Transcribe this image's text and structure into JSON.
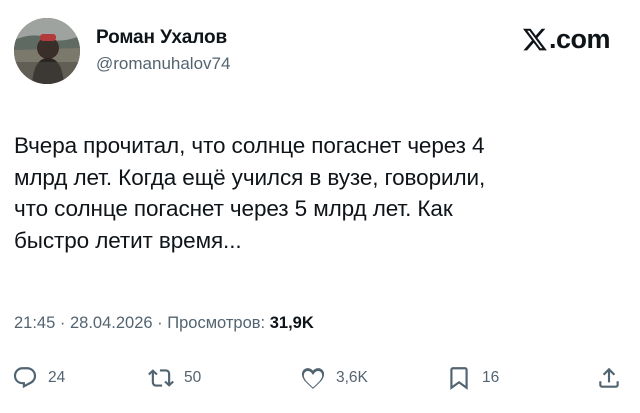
{
  "author": {
    "display_name": "Роман Ухалов",
    "handle": "@romanuhalov74"
  },
  "brand": {
    "text": ".com",
    "icon": "x-logo-icon"
  },
  "tweet": {
    "lines": [
      "Вчера прочитал, что солнце погаснет через 4",
      "млрд лет. Когда ещё учился в вузе, говорили,",
      "что солнце погаснет через 5 млрд лет. Как",
      "быстро летит время..."
    ],
    "time": "21:45",
    "separator": " · ",
    "date": "28.04.2026",
    "views_label": "Просмотров:",
    "views_count": "31,9K"
  },
  "actions": {
    "replies": {
      "icon": "reply-icon",
      "count": "24"
    },
    "reposts": {
      "icon": "repost-icon",
      "count": "50"
    },
    "likes": {
      "icon": "heart-icon",
      "count": "3,6K"
    },
    "bookmarks": {
      "icon": "bookmark-icon",
      "count": "16"
    },
    "share": {
      "icon": "share-icon"
    }
  },
  "colors": {
    "text_primary": "#0f1419",
    "text_secondary": "#536471",
    "background": "#ffffff"
  }
}
